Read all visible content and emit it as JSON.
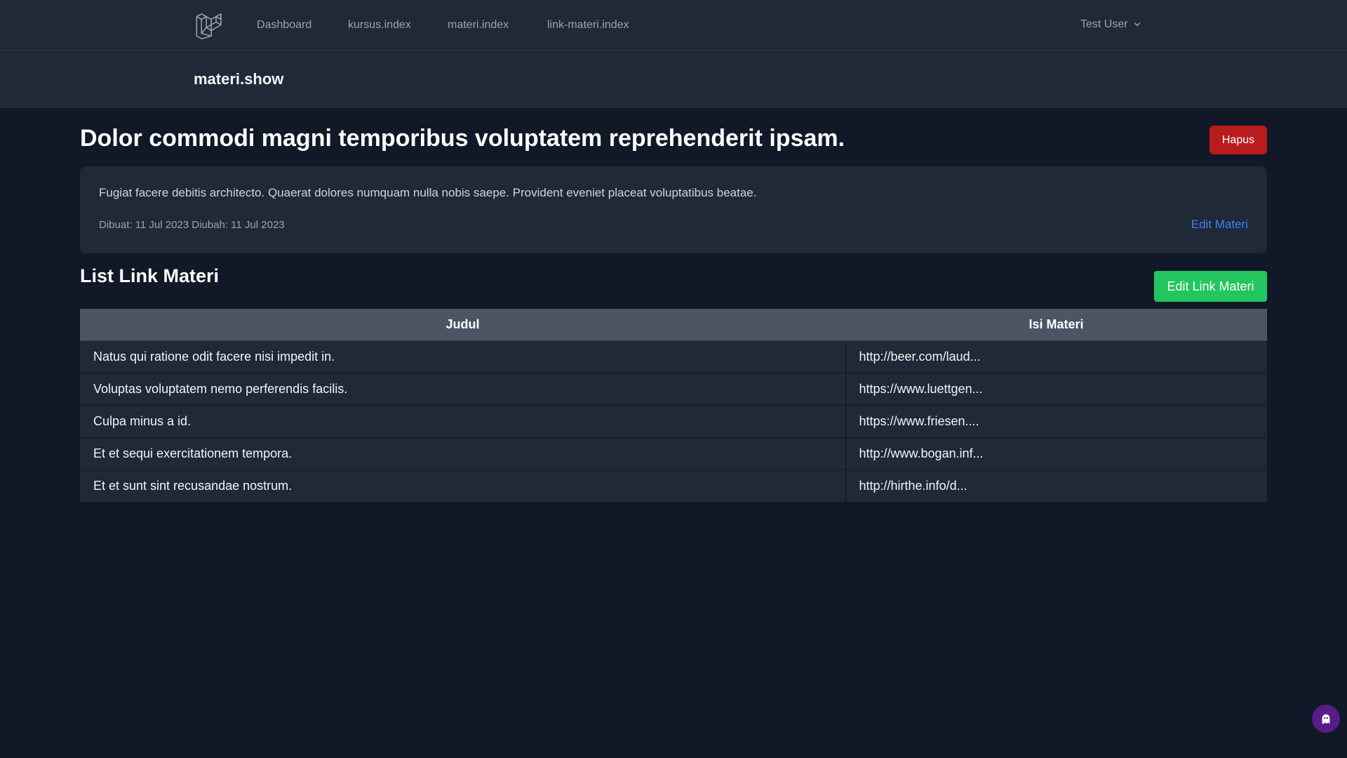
{
  "nav": {
    "links": [
      "Dashboard",
      "kursus.index",
      "materi.index",
      "link-materi.index"
    ],
    "user": "Test User"
  },
  "header": {
    "title": "materi.show"
  },
  "materi": {
    "title": "Dolor commodi magni temporibus voluptatem reprehenderit ipsam.",
    "delete_label": "Hapus",
    "description": "Fugiat facere debitis architecto. Quaerat dolores numquam nulla nobis saepe. Provident eveniet placeat voluptatibus beatae.",
    "meta": "Dibuat: 11 Jul 2023 Diubah: 11 Jul 2023",
    "edit_label": "Edit Materi"
  },
  "links_section": {
    "title": "List Link Materi",
    "edit_label": "Edit Link Materi",
    "columns": [
      "Judul",
      "Isi Materi"
    ],
    "rows": [
      [
        "Natus qui ratione odit facere nisi impedit in.",
        "http://beer.com/laud..."
      ],
      [
        "Voluptas voluptatem nemo perferendis facilis.",
        "https://www.luettgen..."
      ],
      [
        "Culpa minus a id.",
        "https://www.friesen...."
      ],
      [
        "Et et sequi exercitationem tempora.",
        "http://www.bogan.inf..."
      ],
      [
        "Et et sunt sint recusandae nostrum.",
        "http://hirthe.info/d..."
      ]
    ]
  },
  "colors": {
    "background": "#111827",
    "panel": "#1f2937",
    "danger": "#b91c1c",
    "success": "#22c55e",
    "link": "#3b82f6"
  },
  "icons": {
    "logo": "laravel-logo-icon",
    "user_menu": "chevron-down-icon",
    "fab": "ghost-icon"
  }
}
